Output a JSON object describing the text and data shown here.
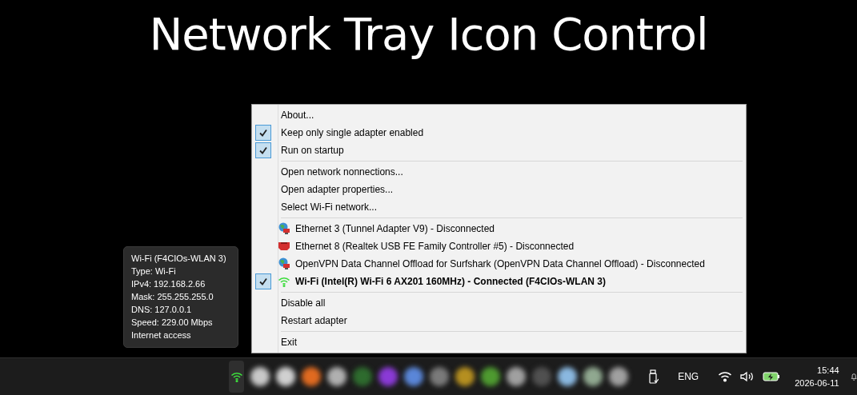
{
  "title": "Network Tray Icon Control",
  "menu": [
    {
      "kind": "item",
      "label": "About...",
      "checked": false
    },
    {
      "kind": "item",
      "label": "Keep only single adapter enabled",
      "checked": true
    },
    {
      "kind": "item",
      "label": "Run on startup",
      "checked": true
    },
    {
      "kind": "separator"
    },
    {
      "kind": "item",
      "label": "Open network nonnections...",
      "checked": false
    },
    {
      "kind": "item",
      "label": "Open adapter properties...",
      "checked": false
    },
    {
      "kind": "item",
      "label": "Select Wi-Fi network...",
      "checked": false
    },
    {
      "kind": "separator"
    },
    {
      "kind": "globe",
      "label": "Ethernet 3 (Tunnel Adapter V9) - Disconnected",
      "checked": false,
      "connected": false
    },
    {
      "kind": "ethernet",
      "label": "Ethernet 8 (Realtek USB FE Family Controller #5) - Disconnected",
      "checked": false,
      "connected": false
    },
    {
      "kind": "globe",
      "label": "OpenVPN Data Channel Offload for Surfshark (OpenVPN Data Channel Offload) - Disconnected",
      "checked": false,
      "connected": false
    },
    {
      "kind": "wifi",
      "label": "Wi-Fi (Intel(R) Wi-Fi 6 AX201 160MHz) - Connected (F4CIOs-WLAN 3)",
      "checked": true,
      "connected": true
    },
    {
      "kind": "separator"
    },
    {
      "kind": "item",
      "label": "Disable all",
      "checked": false
    },
    {
      "kind": "item",
      "label": "Restart adapter",
      "checked": false
    },
    {
      "kind": "separator"
    },
    {
      "kind": "item",
      "label": "Exit",
      "checked": false
    }
  ],
  "tooltip": [
    "Wi-Fi (F4CIOs-WLAN 3)",
    "Type: Wi-Fi",
    "IPv4: 192.168.2.66",
    "Mask: 255.255.255.0",
    "DNS: 127.0.0.1",
    "Speed: 229.00 Mbps",
    "Internet access"
  ],
  "taskbar": {
    "apps": [
      {
        "color": "#c8c8c8"
      },
      {
        "color": "#d0d0d0"
      },
      {
        "color": "#e06a20"
      },
      {
        "color": "#b0b0b0"
      },
      {
        "color": "#2e6b2e"
      },
      {
        "color": "#8a3ad6"
      },
      {
        "color": "#5a86d8"
      },
      {
        "color": "#7a7a7a"
      },
      {
        "color": "#b58f20"
      },
      {
        "color": "#4e9a30"
      },
      {
        "color": "#a0a0a0"
      },
      {
        "color": "#505050"
      },
      {
        "color": "#8ab8e0"
      },
      {
        "color": "#90a890"
      },
      {
        "color": "#a0a0a0"
      }
    ],
    "language": "ENG",
    "time": "15:44",
    "date": "2026-06-11"
  }
}
